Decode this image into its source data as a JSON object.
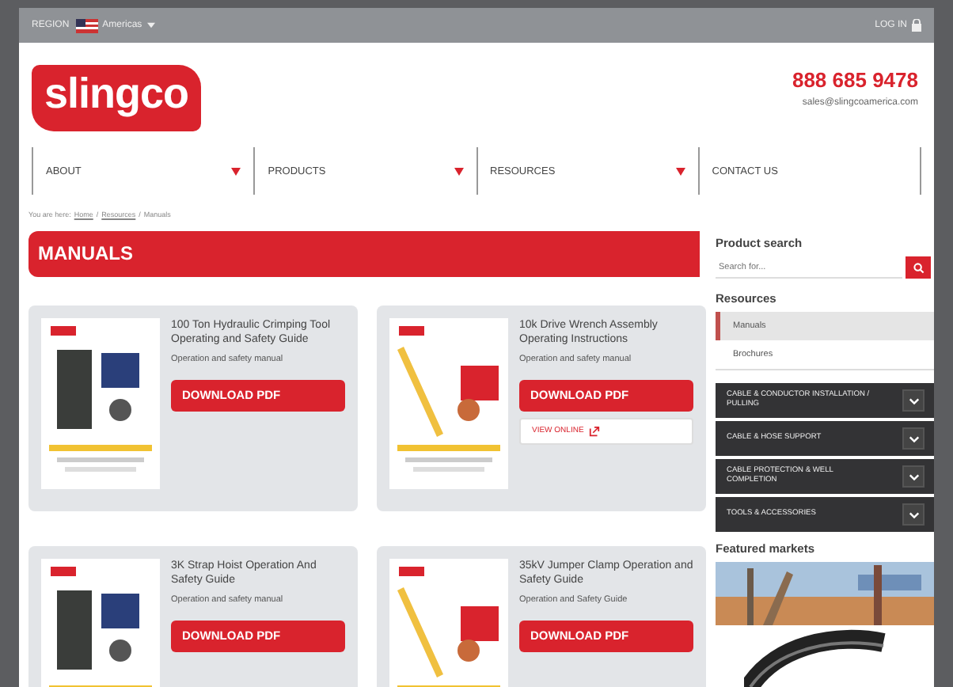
{
  "top_bar": {
    "region_label": "REGION",
    "region": "Americas",
    "login": "LOG IN"
  },
  "header": {
    "logo": "slingco",
    "phone": "888 685 9478",
    "email": "sales@slingcoamerica.com"
  },
  "nav": [
    {
      "label": "ABOUT",
      "has_menu": true
    },
    {
      "label": "PRODUCTS",
      "has_menu": true
    },
    {
      "label": "RESOURCES",
      "has_menu": true
    },
    {
      "label": "CONTACT US",
      "has_menu": false
    }
  ],
  "breadcrumb": {
    "prefix": "You are here:",
    "separator": "/",
    "links": [
      "Home",
      "Resources"
    ],
    "current": "Manuals"
  },
  "heading": "MANUALS",
  "manuals": [
    {
      "title": "100 Ton Hydraulic Crimping Tool Operating and Safety Guide",
      "description": "Operation and safety manual",
      "buttons": [
        {
          "kind": "download",
          "label": "DOWNLOAD PDF"
        }
      ]
    },
    {
      "title": "10k Drive Wrench Assembly Operating Instructions",
      "description": "Operation and safety manual",
      "buttons": [
        {
          "kind": "download",
          "label": "DOWNLOAD PDF"
        },
        {
          "kind": "view",
          "label": "VIEW ONLINE"
        }
      ]
    },
    {
      "title": "3K Strap Hoist Operation And Safety Guide",
      "description": "Operation and safety manual",
      "buttons": [
        {
          "kind": "download",
          "label": "DOWNLOAD PDF"
        }
      ]
    },
    {
      "title": "35kV Jumper Clamp Operation and Safety Guide",
      "description": "Operation and Safety Guide",
      "buttons": [
        {
          "kind": "download",
          "label": "DOWNLOAD PDF"
        }
      ]
    }
  ],
  "sidebar": {
    "search_title": "Product search",
    "search": {
      "placeholder": "Search for..."
    },
    "resources_title": "Resources",
    "resources": [
      {
        "label": "Manuals",
        "selected": true
      },
      {
        "label": "Brochures",
        "selected": false
      }
    ],
    "categories": [
      "CABLE & CONDUCTOR INSTALLATION / PULLING",
      "CABLE & HOSE SUPPORT",
      "CABLE PROTECTION & WELL COMPLETION",
      "TOOLS & ACCESSORIES"
    ],
    "featured_title": "Featured markets"
  }
}
